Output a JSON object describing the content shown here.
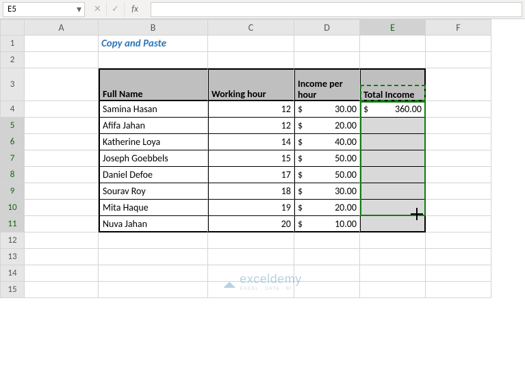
{
  "formula_bar": {
    "cell_ref": "E5",
    "fx_label": "fx",
    "formula": ""
  },
  "columns": [
    "A",
    "B",
    "C",
    "D",
    "E",
    "F"
  ],
  "rows": [
    "1",
    "2",
    "3",
    "4",
    "5",
    "6",
    "7",
    "8",
    "9",
    "10",
    "11",
    "12",
    "13",
    "14",
    "15"
  ],
  "title": "Copy and Paste",
  "table": {
    "headers": {
      "name": "Full Name",
      "hours": "Working hour",
      "rate": "Income per hour",
      "total": "Total Income"
    },
    "rows": [
      {
        "name": "Samina Hasan",
        "hours": "12",
        "rate": "30.00",
        "total": "360.00"
      },
      {
        "name": "Afifa Jahan",
        "hours": "12",
        "rate": "20.00",
        "total": ""
      },
      {
        "name": "Katherine Loya",
        "hours": "14",
        "rate": "40.00",
        "total": ""
      },
      {
        "name": "Joseph Goebbels",
        "hours": "15",
        "rate": "50.00",
        "total": ""
      },
      {
        "name": "Daniel Defoe",
        "hours": "17",
        "rate": "50.00",
        "total": ""
      },
      {
        "name": "Sourav Roy",
        "hours": "18",
        "rate": "30.00",
        "total": ""
      },
      {
        "name": "Mita Haque",
        "hours": "19",
        "rate": "20.00",
        "total": ""
      },
      {
        "name": "Nuva Jahan",
        "hours": "20",
        "rate": "10.00",
        "total": ""
      }
    ]
  },
  "currency_symbol": "$",
  "watermark": {
    "text": "exceldemy",
    "sub": "EXCEL · DATA · BI"
  },
  "selected_cell": "E5",
  "copy_source": "E4",
  "selection_range": "E5:E11"
}
